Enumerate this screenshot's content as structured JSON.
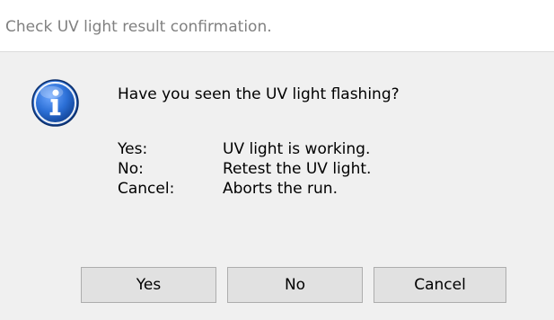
{
  "window": {
    "title": "Check UV light result confirmation."
  },
  "message": {
    "icon": "info-icon",
    "question": "Have you seen the UV light flashing?",
    "options": [
      {
        "key": "Yes:",
        "description": "UV light is working."
      },
      {
        "key": "No:",
        "description": "Retest the UV light."
      },
      {
        "key": "Cancel:",
        "description": "Aborts the run."
      }
    ]
  },
  "buttons": {
    "yes_label": "Yes",
    "no_label": "No",
    "cancel_label": "Cancel"
  },
  "colors": {
    "title_bar_bg": "#ffffff",
    "dialog_bg": "#f0f0f0",
    "button_bg": "#e1e1e1",
    "button_border": "#adadad",
    "icon_blue": "#1a5fb4"
  }
}
